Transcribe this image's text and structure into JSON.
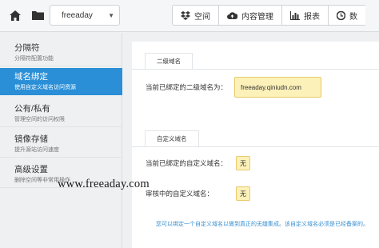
{
  "topbar": {
    "bucket_name": "freeaday",
    "tabs": [
      {
        "icon": "dropbox-icon",
        "label": "空间"
      },
      {
        "icon": "cloud-upload-icon",
        "label": "内容管理"
      },
      {
        "icon": "bar-chart-icon",
        "label": "报表"
      },
      {
        "icon": "data-icon",
        "label": "数"
      }
    ]
  },
  "sidebar": {
    "items": [
      {
        "title": "分隔符",
        "subtitle": "分隔符配置功能"
      },
      {
        "title": "域名绑定",
        "subtitle": "使用自定义域名访问资源"
      },
      {
        "title": "公有/私有",
        "subtitle": "管理空间的访问权限"
      },
      {
        "title": "镜像存储",
        "subtitle": "提升源站访问速度"
      },
      {
        "title": "高级设置",
        "subtitle": "删除空间等非常用操作"
      }
    ]
  },
  "main": {
    "secondary": {
      "header": "二级域名",
      "label": "当前已绑定的二级域名为：",
      "value": "freeaday.qiniudn.com"
    },
    "custom": {
      "header": "自定义域名",
      "bound_label": "当前已绑定的自定义域名：",
      "bound_value": "无",
      "pending_label": "审核中的自定义域名：",
      "pending_value": "无"
    },
    "hint": "您可以绑定一个自定义域名以做到真正的无缝集成。该自定义域名必须是已经备案的。"
  },
  "watermark": "www.freeaday.com",
  "colors": {
    "accent": "#2a8fd6",
    "highlight": "#fcf1b9"
  }
}
